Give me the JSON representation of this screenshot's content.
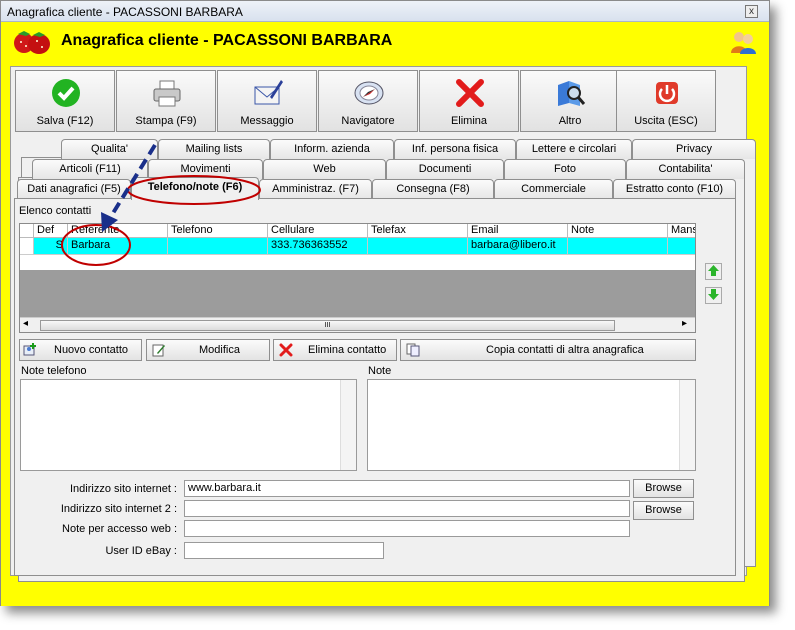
{
  "window": {
    "title": "Anagrafica cliente - PACASSONI BARBARA",
    "close_glyph": "x"
  },
  "header": {
    "title": "Anagrafica cliente - PACASSONI BARBARA",
    "logo_icon": "strawberries-icon",
    "user_icon": "users-icon"
  },
  "toolbar": [
    {
      "label": "Salva (F12)",
      "icon": "check-icon"
    },
    {
      "label": "Stampa (F9)",
      "icon": "printer-icon"
    },
    {
      "label": "Messaggio",
      "icon": "envelope-icon"
    },
    {
      "label": "Navigatore",
      "icon": "compass-icon"
    },
    {
      "label": "Elimina",
      "icon": "delete-x-icon"
    },
    {
      "label": "Altro",
      "icon": "search-book-icon"
    },
    {
      "label": "Uscita (ESC)",
      "icon": "power-icon"
    }
  ],
  "tabs_row1": [
    "Qualita'",
    "Mailing lists",
    "Inform. azienda",
    "Inf. persona fisica",
    "Lettere e circolari",
    "Privacy"
  ],
  "tabs_row2": [
    "Articoli (F11)",
    "Movimenti",
    "Web",
    "Documenti",
    "Foto",
    "Contabilita'"
  ],
  "tabs_row3": [
    "Dati anagrafici (F5)",
    "Telefono/note (F6)",
    "Amministraz. (F7)",
    "Consegna (F8)",
    "Commerciale",
    "Estratto conto (F10)"
  ],
  "active_tab": "Telefono/note (F6)",
  "contacts": {
    "section_label": "Elenco contatti",
    "columns": [
      "Def",
      "Referente",
      "Telefono",
      "Cellulare",
      "Telefax",
      "Email",
      "Note",
      "Mans"
    ],
    "rows": [
      [
        "S",
        "Barbara",
        "",
        "333.736363552",
        "",
        "barbara@libero.it",
        "",
        ""
      ]
    ],
    "scroll_thumb_glyph": "III",
    "scroll_left": "◂",
    "scroll_right": "▸"
  },
  "actions": [
    {
      "label": "Nuovo contatto",
      "icon": "new-contact-icon"
    },
    {
      "label": "Modifica",
      "icon": "edit-icon"
    },
    {
      "label": "Elimina contatto",
      "icon": "delete-x-icon"
    },
    {
      "label": "Copia contatti di altra anagrafica",
      "icon": "copy-icon"
    }
  ],
  "notes": {
    "phone_label": "Note telefono",
    "notes_label": "Note"
  },
  "fields": [
    {
      "label": "Indirizzo sito internet :",
      "value": "www.barbara.it",
      "button": "Browse"
    },
    {
      "label": "Indirizzo sito internet 2 :",
      "value": "",
      "button": "Browse"
    },
    {
      "label": "Note per accesso web :",
      "value": ""
    },
    {
      "label": "User ID eBay :",
      "value": ""
    }
  ],
  "colors": {
    "accent": "#ffff00",
    "selected_row": "#00ffff",
    "annotation": "#c00000",
    "arrow": "#1a2f8a"
  }
}
